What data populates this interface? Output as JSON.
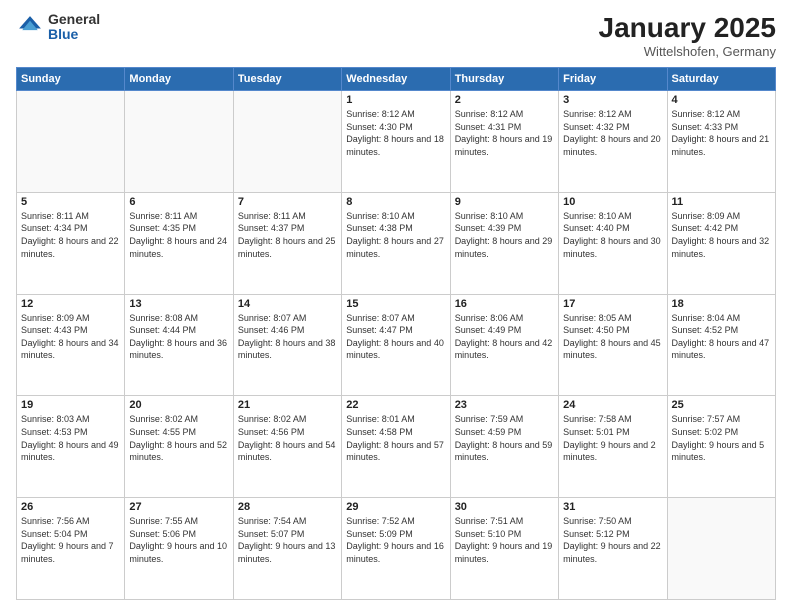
{
  "logo": {
    "general": "General",
    "blue": "Blue"
  },
  "header": {
    "month": "January 2025",
    "location": "Wittelshofen, Germany"
  },
  "weekdays": [
    "Sunday",
    "Monday",
    "Tuesday",
    "Wednesday",
    "Thursday",
    "Friday",
    "Saturday"
  ],
  "weeks": [
    [
      {
        "day": "",
        "content": ""
      },
      {
        "day": "",
        "content": ""
      },
      {
        "day": "",
        "content": ""
      },
      {
        "day": "1",
        "content": "Sunrise: 8:12 AM\nSunset: 4:30 PM\nDaylight: 8 hours and 18 minutes."
      },
      {
        "day": "2",
        "content": "Sunrise: 8:12 AM\nSunset: 4:31 PM\nDaylight: 8 hours and 19 minutes."
      },
      {
        "day": "3",
        "content": "Sunrise: 8:12 AM\nSunset: 4:32 PM\nDaylight: 8 hours and 20 minutes."
      },
      {
        "day": "4",
        "content": "Sunrise: 8:12 AM\nSunset: 4:33 PM\nDaylight: 8 hours and 21 minutes."
      }
    ],
    [
      {
        "day": "5",
        "content": "Sunrise: 8:11 AM\nSunset: 4:34 PM\nDaylight: 8 hours and 22 minutes."
      },
      {
        "day": "6",
        "content": "Sunrise: 8:11 AM\nSunset: 4:35 PM\nDaylight: 8 hours and 24 minutes."
      },
      {
        "day": "7",
        "content": "Sunrise: 8:11 AM\nSunset: 4:37 PM\nDaylight: 8 hours and 25 minutes."
      },
      {
        "day": "8",
        "content": "Sunrise: 8:10 AM\nSunset: 4:38 PM\nDaylight: 8 hours and 27 minutes."
      },
      {
        "day": "9",
        "content": "Sunrise: 8:10 AM\nSunset: 4:39 PM\nDaylight: 8 hours and 29 minutes."
      },
      {
        "day": "10",
        "content": "Sunrise: 8:10 AM\nSunset: 4:40 PM\nDaylight: 8 hours and 30 minutes."
      },
      {
        "day": "11",
        "content": "Sunrise: 8:09 AM\nSunset: 4:42 PM\nDaylight: 8 hours and 32 minutes."
      }
    ],
    [
      {
        "day": "12",
        "content": "Sunrise: 8:09 AM\nSunset: 4:43 PM\nDaylight: 8 hours and 34 minutes."
      },
      {
        "day": "13",
        "content": "Sunrise: 8:08 AM\nSunset: 4:44 PM\nDaylight: 8 hours and 36 minutes."
      },
      {
        "day": "14",
        "content": "Sunrise: 8:07 AM\nSunset: 4:46 PM\nDaylight: 8 hours and 38 minutes."
      },
      {
        "day": "15",
        "content": "Sunrise: 8:07 AM\nSunset: 4:47 PM\nDaylight: 8 hours and 40 minutes."
      },
      {
        "day": "16",
        "content": "Sunrise: 8:06 AM\nSunset: 4:49 PM\nDaylight: 8 hours and 42 minutes."
      },
      {
        "day": "17",
        "content": "Sunrise: 8:05 AM\nSunset: 4:50 PM\nDaylight: 8 hours and 45 minutes."
      },
      {
        "day": "18",
        "content": "Sunrise: 8:04 AM\nSunset: 4:52 PM\nDaylight: 8 hours and 47 minutes."
      }
    ],
    [
      {
        "day": "19",
        "content": "Sunrise: 8:03 AM\nSunset: 4:53 PM\nDaylight: 8 hours and 49 minutes."
      },
      {
        "day": "20",
        "content": "Sunrise: 8:02 AM\nSunset: 4:55 PM\nDaylight: 8 hours and 52 minutes."
      },
      {
        "day": "21",
        "content": "Sunrise: 8:02 AM\nSunset: 4:56 PM\nDaylight: 8 hours and 54 minutes."
      },
      {
        "day": "22",
        "content": "Sunrise: 8:01 AM\nSunset: 4:58 PM\nDaylight: 8 hours and 57 minutes."
      },
      {
        "day": "23",
        "content": "Sunrise: 7:59 AM\nSunset: 4:59 PM\nDaylight: 8 hours and 59 minutes."
      },
      {
        "day": "24",
        "content": "Sunrise: 7:58 AM\nSunset: 5:01 PM\nDaylight: 9 hours and 2 minutes."
      },
      {
        "day": "25",
        "content": "Sunrise: 7:57 AM\nSunset: 5:02 PM\nDaylight: 9 hours and 5 minutes."
      }
    ],
    [
      {
        "day": "26",
        "content": "Sunrise: 7:56 AM\nSunset: 5:04 PM\nDaylight: 9 hours and 7 minutes."
      },
      {
        "day": "27",
        "content": "Sunrise: 7:55 AM\nSunset: 5:06 PM\nDaylight: 9 hours and 10 minutes."
      },
      {
        "day": "28",
        "content": "Sunrise: 7:54 AM\nSunset: 5:07 PM\nDaylight: 9 hours and 13 minutes."
      },
      {
        "day": "29",
        "content": "Sunrise: 7:52 AM\nSunset: 5:09 PM\nDaylight: 9 hours and 16 minutes."
      },
      {
        "day": "30",
        "content": "Sunrise: 7:51 AM\nSunset: 5:10 PM\nDaylight: 9 hours and 19 minutes."
      },
      {
        "day": "31",
        "content": "Sunrise: 7:50 AM\nSunset: 5:12 PM\nDaylight: 9 hours and 22 minutes."
      },
      {
        "day": "",
        "content": ""
      }
    ]
  ]
}
